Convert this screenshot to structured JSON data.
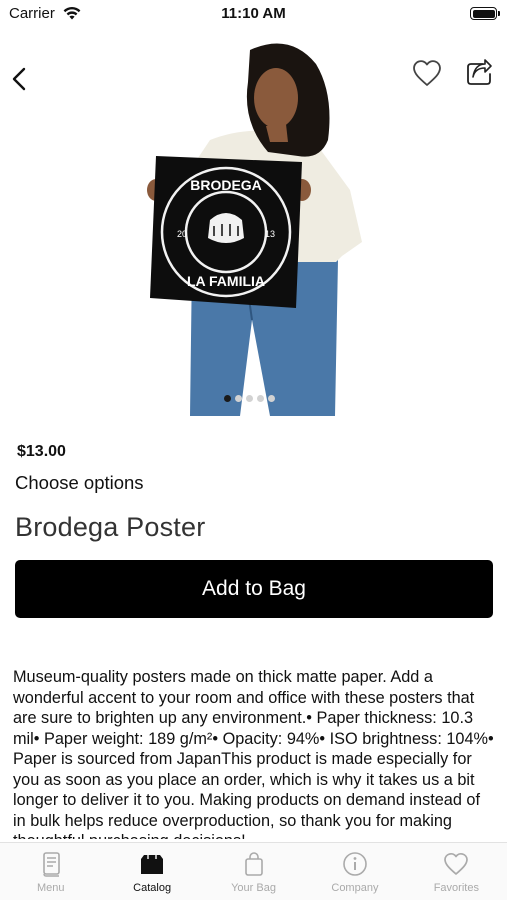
{
  "status_bar": {
    "carrier": "Carrier",
    "time": "11:10 AM"
  },
  "product": {
    "price": "$13.00",
    "options_label": "Choose options",
    "title": "Brodega Poster",
    "add_to_bag_label": "Add to Bag",
    "description": "Museum-quality posters made on thick matte paper. Add a wonderful accent to your room and office with these posters that are sure to brighten up any environment.• Paper thickness: 10.3 mil• Paper weight: 189 g/m²• Opacity: 94%• ISO brightness: 104%• Paper is sourced from JapanThis product is made especially for you as soon as you place an order, which is why it takes us a bit longer to deliver it to you. Making products on demand instead of in bulk helps reduce overproduction, so thank you for making thoughtful purchasing decisions!",
    "image_gallery": {
      "count": 5,
      "active_index": 0
    },
    "poster_text": {
      "top": "BRODEGA",
      "bottom": "LA FAMILIA",
      "year_left": "20",
      "year_right": "13"
    }
  },
  "tab_bar": {
    "items": [
      {
        "label": "Menu",
        "icon": "menu-book-icon",
        "active": false
      },
      {
        "label": "Catalog",
        "icon": "catalog-icon",
        "active": true
      },
      {
        "label": "Your Bag",
        "icon": "bag-icon",
        "active": false
      },
      {
        "label": "Company",
        "icon": "info-icon",
        "active": false
      },
      {
        "label": "Favorites",
        "icon": "heart-icon",
        "active": false
      }
    ]
  },
  "colors": {
    "accent": "#000000",
    "inactive_tab": "#aaaaaa",
    "dot_inactive": "#d2d2d2"
  }
}
